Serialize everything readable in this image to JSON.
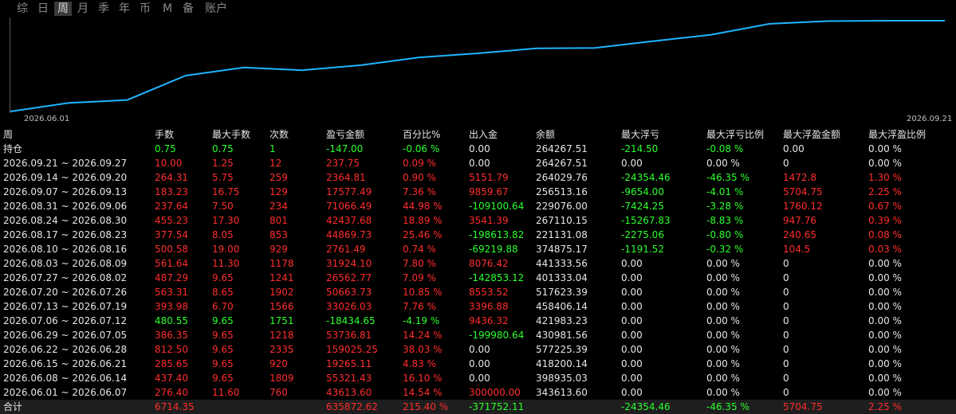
{
  "tabs": [
    "综",
    "日",
    "周",
    "月",
    "季",
    "年",
    "币",
    "M",
    "备",
    "账户"
  ],
  "active_tab": 2,
  "chart_data": {
    "type": "line",
    "x_start_label": "2026.06.01",
    "x_end_label": "2026.09.21",
    "line_color": "#1fb4ff",
    "x": [
      "2026.06.01",
      "2026.06.08",
      "2026.06.15",
      "2026.06.22",
      "2026.06.29",
      "2026.07.06",
      "2026.07.13",
      "2026.07.20",
      "2026.07.27",
      "2026.08.03",
      "2026.08.10",
      "2026.08.17",
      "2026.08.24",
      "2026.08.31",
      "2026.09.07",
      "2026.09.14",
      "2026.09.21"
    ],
    "values": [
      43613.6,
      98935.01,
      118200.14,
      277225.39,
      330981.56,
      312546.92,
      345573.95,
      396237.68,
      422800.45,
      454724.96,
      457486.45,
      501956.28,
      544398.96,
      615469.85,
      633047.34,
      635411.76,
      635649.51
    ]
  },
  "table": {
    "headers": [
      "周",
      "手数",
      "最大手数",
      "次数",
      "盈亏金额",
      "百分比%",
      "出入金",
      "余额",
      "最大浮亏",
      "最大浮亏比例",
      "最大浮盈金额",
      "最大浮盈比例"
    ],
    "rows": [
      {
        "c": [
          "持仓",
          "0.75",
          "0.75",
          "1",
          "-147.00",
          "-0.06 %",
          "0.00",
          "264267.51",
          "-214.50",
          "-0.08 %",
          "0.00",
          "0.00 %"
        ],
        "k": [
          "w",
          "g",
          "g",
          "g",
          "g",
          "g",
          "w",
          "w",
          "g",
          "g",
          "w",
          "w"
        ]
      },
      {
        "c": [
          "2026.09.21 ~ 2026.09.27",
          "10.00",
          "1.25",
          "12",
          "237.75",
          "0.09 %",
          "0.00",
          "264267.51",
          "0.00",
          "0.00 %",
          "0",
          "0.00 %"
        ],
        "k": [
          "w",
          "r",
          "r",
          "r",
          "r",
          "r",
          "w",
          "w",
          "w",
          "w",
          "w",
          "w"
        ]
      },
      {
        "c": [
          "2026.09.14 ~ 2026.09.20",
          "264.31",
          "5.75",
          "259",
          "2364.81",
          "0.90 %",
          "5151.79",
          "264029.76",
          "-24354.46",
          "-46.35 %",
          "1472.8",
          "1.30 %"
        ],
        "k": [
          "w",
          "r",
          "r",
          "r",
          "r",
          "r",
          "r",
          "w",
          "g",
          "g",
          "r",
          "r"
        ]
      },
      {
        "c": [
          "2026.09.07 ~ 2026.09.13",
          "183.23",
          "16.75",
          "129",
          "17577.49",
          "7.36 %",
          "9859.67",
          "256513.16",
          "-9654.00",
          "-4.01 %",
          "5704.75",
          "2.25 %"
        ],
        "k": [
          "w",
          "r",
          "r",
          "r",
          "r",
          "r",
          "r",
          "w",
          "g",
          "g",
          "r",
          "r"
        ]
      },
      {
        "c": [
          "2026.08.31 ~ 2026.09.06",
          "237.64",
          "7.50",
          "234",
          "71066.49",
          "44.98 %",
          "-109100.64",
          "229076.00",
          "-7424.25",
          "-3.28 %",
          "1760.12",
          "0.67 %"
        ],
        "k": [
          "w",
          "r",
          "r",
          "r",
          "r",
          "r",
          "g",
          "w",
          "g",
          "g",
          "r",
          "r"
        ]
      },
      {
        "c": [
          "2026.08.24 ~ 2026.08.30",
          "455.23",
          "17.30",
          "801",
          "42437.68",
          "18.89 %",
          "3541.39",
          "267110.15",
          "-15267.83",
          "-8.83 %",
          "947.76",
          "0.39 %"
        ],
        "k": [
          "w",
          "r",
          "r",
          "r",
          "r",
          "r",
          "r",
          "w",
          "g",
          "g",
          "r",
          "r"
        ]
      },
      {
        "c": [
          "2026.08.17 ~ 2026.08.23",
          "377.54",
          "8.05",
          "853",
          "44869.73",
          "25.46 %",
          "-198613.82",
          "221131.08",
          "-2275.06",
          "-0.80 %",
          "240.65",
          "0.08 %"
        ],
        "k": [
          "w",
          "r",
          "r",
          "r",
          "r",
          "r",
          "g",
          "w",
          "g",
          "g",
          "r",
          "r"
        ]
      },
      {
        "c": [
          "2026.08.10 ~ 2026.08.16",
          "500.58",
          "19.00",
          "929",
          "2761.49",
          "0.74 %",
          "-69219.88",
          "374875.17",
          "-1191.52",
          "-0.32 %",
          "104.5",
          "0.03 %"
        ],
        "k": [
          "w",
          "r",
          "r",
          "r",
          "r",
          "r",
          "g",
          "w",
          "g",
          "g",
          "r",
          "r"
        ]
      },
      {
        "c": [
          "2026.08.03 ~ 2026.08.09",
          "561.64",
          "11.30",
          "1178",
          "31924.10",
          "7.80 %",
          "8076.42",
          "441333.56",
          "0.00",
          "0.00 %",
          "0",
          "0.00 %"
        ],
        "k": [
          "w",
          "r",
          "r",
          "r",
          "r",
          "r",
          "r",
          "w",
          "w",
          "w",
          "w",
          "w"
        ]
      },
      {
        "c": [
          "2026.07.27 ~ 2026.08.02",
          "487.29",
          "9.65",
          "1241",
          "26562.77",
          "7.09 %",
          "-142853.12",
          "401333.04",
          "0.00",
          "0.00 %",
          "0",
          "0.00 %"
        ],
        "k": [
          "w",
          "r",
          "r",
          "r",
          "r",
          "r",
          "g",
          "w",
          "w",
          "w",
          "w",
          "w"
        ]
      },
      {
        "c": [
          "2026.07.20 ~ 2026.07.26",
          "563.31",
          "8.65",
          "1902",
          "50663.73",
          "10.85 %",
          "8553.52",
          "517623.39",
          "0.00",
          "0.00 %",
          "0",
          "0.00 %"
        ],
        "k": [
          "w",
          "r",
          "r",
          "r",
          "r",
          "r",
          "r",
          "w",
          "w",
          "w",
          "w",
          "w"
        ]
      },
      {
        "c": [
          "2026.07.13 ~ 2026.07.19",
          "393.98",
          "6.70",
          "1566",
          "33026.03",
          "7.76 %",
          "3396.88",
          "458406.14",
          "0.00",
          "0.00 %",
          "0",
          "0.00 %"
        ],
        "k": [
          "w",
          "r",
          "r",
          "r",
          "r",
          "r",
          "r",
          "w",
          "w",
          "w",
          "w",
          "w"
        ]
      },
      {
        "c": [
          "2026.07.06 ~ 2026.07.12",
          "480.55",
          "9.65",
          "1751",
          "-18434.65",
          "-4.19 %",
          "9436.32",
          "421983.23",
          "0.00",
          "0.00 %",
          "0",
          "0.00 %"
        ],
        "k": [
          "w",
          "g",
          "g",
          "g",
          "g",
          "g",
          "r",
          "w",
          "w",
          "w",
          "w",
          "w"
        ]
      },
      {
        "c": [
          "2026.06.29 ~ 2026.07.05",
          "386.35",
          "9.65",
          "1218",
          "53736.81",
          "14.24 %",
          "-199980.64",
          "430981.56",
          "0.00",
          "0.00 %",
          "0",
          "0.00 %"
        ],
        "k": [
          "w",
          "r",
          "r",
          "r",
          "r",
          "r",
          "g",
          "w",
          "w",
          "w",
          "w",
          "w"
        ]
      },
      {
        "c": [
          "2026.06.22 ~ 2026.06.28",
          "812.50",
          "9.65",
          "2335",
          "159025.25",
          "38.03 %",
          "0.00",
          "577225.39",
          "0.00",
          "0.00 %",
          "0",
          "0.00 %"
        ],
        "k": [
          "w",
          "r",
          "r",
          "r",
          "r",
          "r",
          "w",
          "w",
          "w",
          "w",
          "w",
          "w"
        ]
      },
      {
        "c": [
          "2026.06.15 ~ 2026.06.21",
          "285.65",
          "9.65",
          "920",
          "19265.11",
          "4.83 %",
          "0.00",
          "418200.14",
          "0.00",
          "0.00 %",
          "0",
          "0.00 %"
        ],
        "k": [
          "w",
          "r",
          "r",
          "r",
          "r",
          "r",
          "w",
          "w",
          "w",
          "w",
          "w",
          "w"
        ]
      },
      {
        "c": [
          "2026.06.08 ~ 2026.06.14",
          "437.40",
          "9.65",
          "1809",
          "55321.43",
          "16.10 %",
          "0.00",
          "398935.03",
          "0.00",
          "0.00 %",
          "0",
          "0.00 %"
        ],
        "k": [
          "w",
          "r",
          "r",
          "r",
          "r",
          "r",
          "w",
          "w",
          "w",
          "w",
          "w",
          "w"
        ]
      },
      {
        "c": [
          "2026.06.01 ~ 2026.06.07",
          "276.40",
          "11.60",
          "760",
          "43613.60",
          "14.54 %",
          "300000.00",
          "343613.60",
          "0.00",
          "0.00 %",
          "0",
          "0.00 %"
        ],
        "k": [
          "w",
          "r",
          "r",
          "r",
          "r",
          "r",
          "r",
          "w",
          "w",
          "w",
          "w",
          "w"
        ]
      }
    ],
    "total": {
      "c": [
        "合计",
        "6714.35",
        "",
        "",
        "635872.62",
        "215.40 %",
        "-371752.11",
        "",
        "-24354.46",
        "-46.35 %",
        "5704.75",
        "2.25 %"
      ],
      "k": [
        "w",
        "r",
        "w",
        "w",
        "r",
        "r",
        "g",
        "w",
        "g",
        "g",
        "r",
        "r"
      ]
    }
  },
  "colors": {
    "red": "#ff2d2d",
    "green": "#2cff2c",
    "line": "#1fb4ff"
  }
}
